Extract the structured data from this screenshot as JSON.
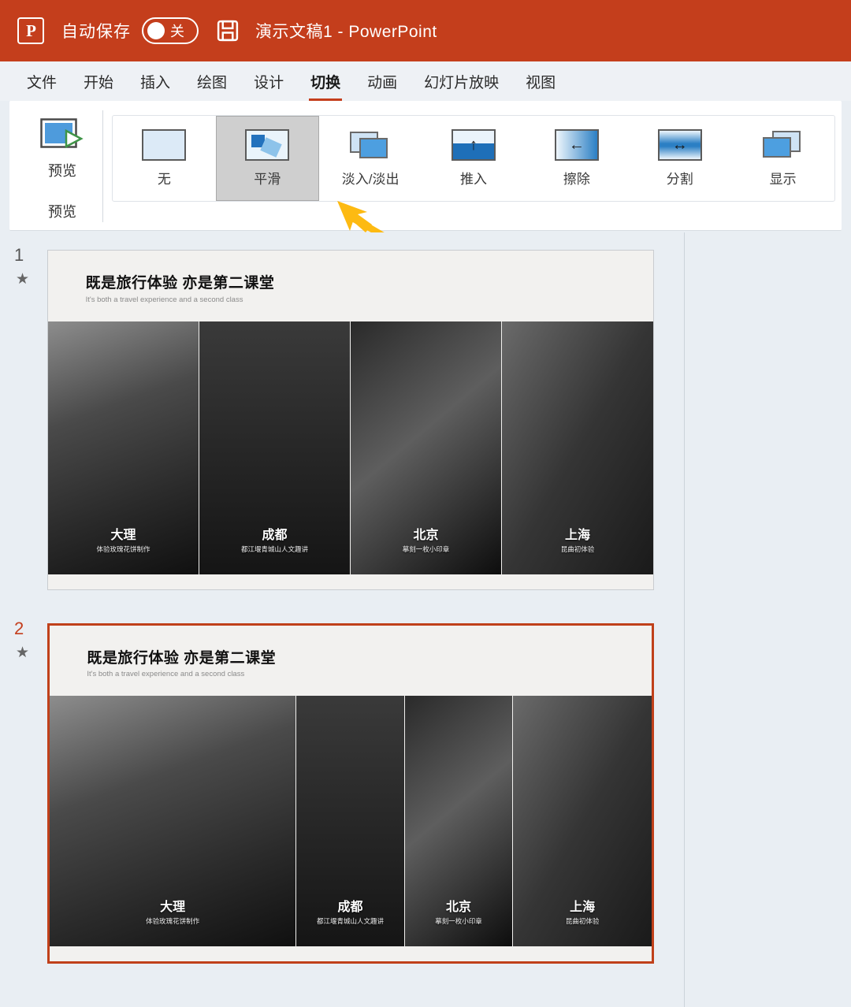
{
  "titlebar": {
    "logo_text": "P",
    "autosave_label": "自动保存",
    "toggle_state": "关",
    "save_icon": "floppy-disk-icon",
    "document_title": "演示文稿1  -  PowerPoint"
  },
  "menubar": {
    "items": [
      {
        "label": "文件",
        "active": false
      },
      {
        "label": "开始",
        "active": false
      },
      {
        "label": "插入",
        "active": false
      },
      {
        "label": "绘图",
        "active": false
      },
      {
        "label": "设计",
        "active": false
      },
      {
        "label": "切换",
        "active": true
      },
      {
        "label": "动画",
        "active": false
      },
      {
        "label": "幻灯片放映",
        "active": false
      },
      {
        "label": "视图",
        "active": false
      }
    ]
  },
  "ribbon": {
    "preview_button_label": "预览",
    "preview_group_label": "预览",
    "preview_icon": "play-preview-icon",
    "transitions": [
      {
        "label": "无",
        "icon": "none-transition-icon",
        "selected": false
      },
      {
        "label": "平滑",
        "icon": "morph-transition-icon",
        "selected": true
      },
      {
        "label": "淡入/淡出",
        "icon": "fade-transition-icon",
        "selected": false
      },
      {
        "label": "推入",
        "icon": "push-transition-icon",
        "selected": false
      },
      {
        "label": "擦除",
        "icon": "wipe-transition-icon",
        "selected": false
      },
      {
        "label": "分割",
        "icon": "split-transition-icon",
        "selected": false
      },
      {
        "label": "显示",
        "icon": "reveal-transition-icon",
        "selected": false
      }
    ]
  },
  "annotation": {
    "arrow_color": "#FDBA12",
    "arrow_points_to": "morph-transition-button"
  },
  "slides": [
    {
      "number": "1",
      "has_transition_star": true,
      "selected": false,
      "title": "既是旅行体验 亦是第二课堂",
      "subtitle": "It's both a travel experience and a second class",
      "photos": [
        {
          "city": "大理",
          "desc": "体验玫瑰花饼制作",
          "width_pct": 25
        },
        {
          "city": "成都",
          "desc": "都江堰青城山人文趣讲",
          "width_pct": 25
        },
        {
          "city": "北京",
          "desc": "摹刻一枚小印章",
          "width_pct": 25
        },
        {
          "city": "上海",
          "desc": "昆曲初体验",
          "width_pct": 25
        }
      ]
    },
    {
      "number": "2",
      "has_transition_star": true,
      "selected": true,
      "title": "既是旅行体验 亦是第二课堂",
      "subtitle": "It's both a travel experience and a second class",
      "photos": [
        {
          "city": "大理",
          "desc": "体验玫瑰花饼制作",
          "width_pct": 41
        },
        {
          "city": "成都",
          "desc": "都江堰青城山人文趣讲",
          "width_pct": 18
        },
        {
          "city": "北京",
          "desc": "摹刻一枚小印章",
          "width_pct": 18
        },
        {
          "city": "上海",
          "desc": "昆曲初体验",
          "width_pct": 23
        }
      ]
    }
  ],
  "colors": {
    "brand_orange": "#c43e1c",
    "selection_orange": "#c0401a",
    "panel_bg": "#e9eef3",
    "slide_bg": "#f2f1ef",
    "annotation_yellow": "#FDBA12"
  }
}
